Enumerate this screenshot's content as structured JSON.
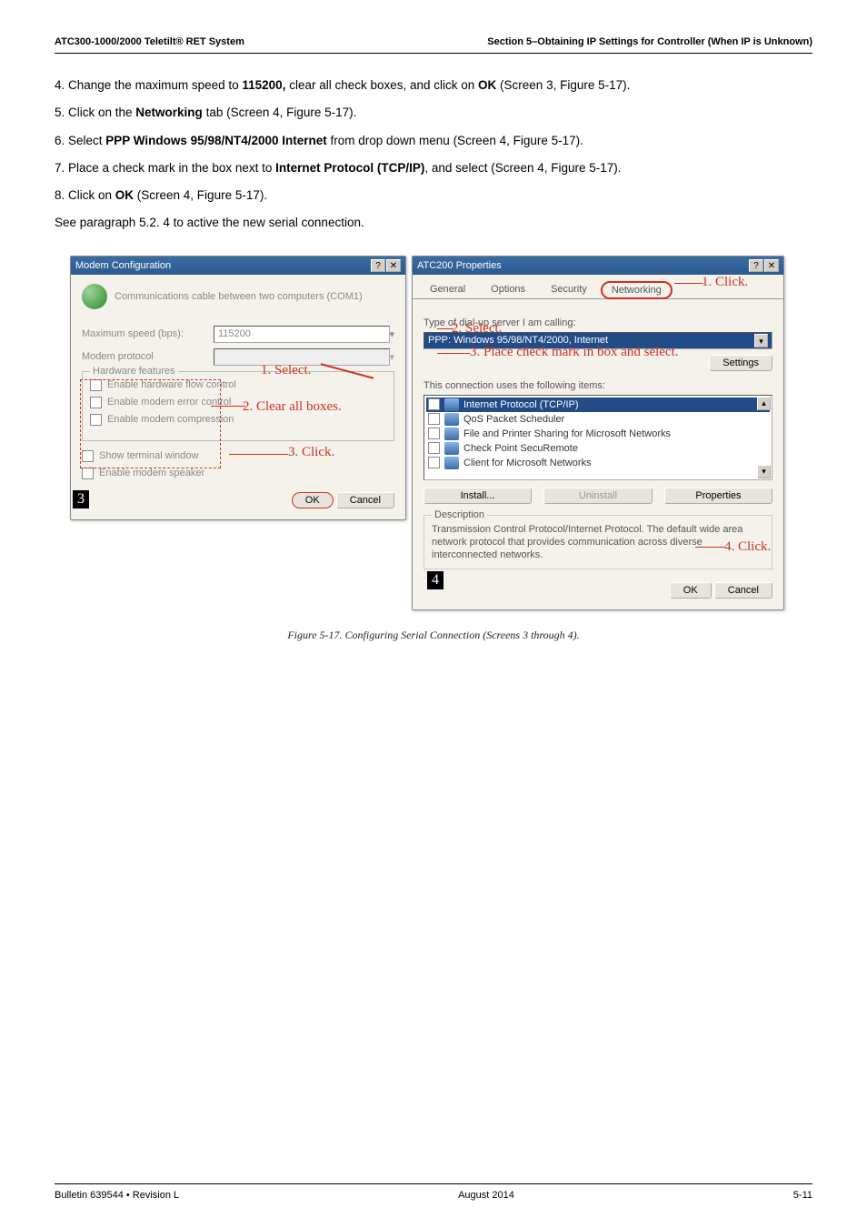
{
  "header": {
    "left": "ATC300-1000/2000 Teletilt® RET System",
    "right": "Section 5–Obtaining IP Settings for Controller (When IP is Unknown)"
  },
  "body": {
    "p4": "4. Change the maximum speed to 115200, clear all check boxes, and click on OK (Screen 3, Figure 5-17).",
    "p5": "5. Click on the Networking tab (Screen 4, Figure 5-17).",
    "p6": "6. Select PPP Windows 95/98/NT4/2000 Internet from drop down menu (Screen 4, Figure 5-17).",
    "p7": "7. Place a check mark in the box next to Internet Protocol (TCP/IP), and select (Screen 4, Figure 5-17).",
    "p8": "8. Click on OK (Screen 4, Figure 5-17).",
    "p9": "See paragraph 5.2. 4 to active the new serial connection."
  },
  "modem": {
    "title": "Modem Configuration",
    "comm": "Communications cable between two computers (COM1)",
    "max_speed_label": "Maximum speed (bps):",
    "max_speed_value": "115200",
    "proto_label": "Modem protocol",
    "features_legend": "Hardware features",
    "chk1": "Enable hardware flow control",
    "chk2": "Enable modem error control",
    "chk3": "Enable modem compression",
    "chk4": "Show terminal window",
    "chk5": "Enable modem speaker",
    "ok": "OK",
    "cancel": "Cancel"
  },
  "atc": {
    "title": "ATC200 Properties",
    "tabs": {
      "general": "General",
      "options": "Options",
      "security": "Security",
      "networking": "Networking"
    },
    "type_label": "Type of dial-up server I am calling:",
    "type_value": "PPP: Windows 95/98/NT4/2000, Internet",
    "settings": "Settings",
    "items_label": "This connection uses the following items:",
    "items": [
      "Internet Protocol (TCP/IP)",
      "QoS Packet Scheduler",
      "File and Printer Sharing for Microsoft Networks",
      "Check Point SecuRemote",
      "Client for Microsoft Networks"
    ],
    "install": "Install...",
    "uninstall": "Uninstall",
    "properties": "Properties",
    "desc_legend": "Description",
    "desc": "Transmission Control Protocol/Internet Protocol. The default wide area network protocol that provides communication across diverse interconnected networks.",
    "ok": "OK",
    "cancel": "Cancel"
  },
  "annots": {
    "a1": "1. Click.",
    "a2": "2. Select.",
    "a3": "3. Place check mark in box and select.",
    "b1": "1. Select.",
    "b2": "2. Clear all boxes.",
    "b3": "3. Click.",
    "a4": "4. Click."
  },
  "caption": "Figure 5-17.  Configuring Serial Connection (Screens 3 through 4).",
  "footer": {
    "left": "Bulletin 639544  •  Revision L",
    "center": "August 2014",
    "right": "5-11"
  }
}
